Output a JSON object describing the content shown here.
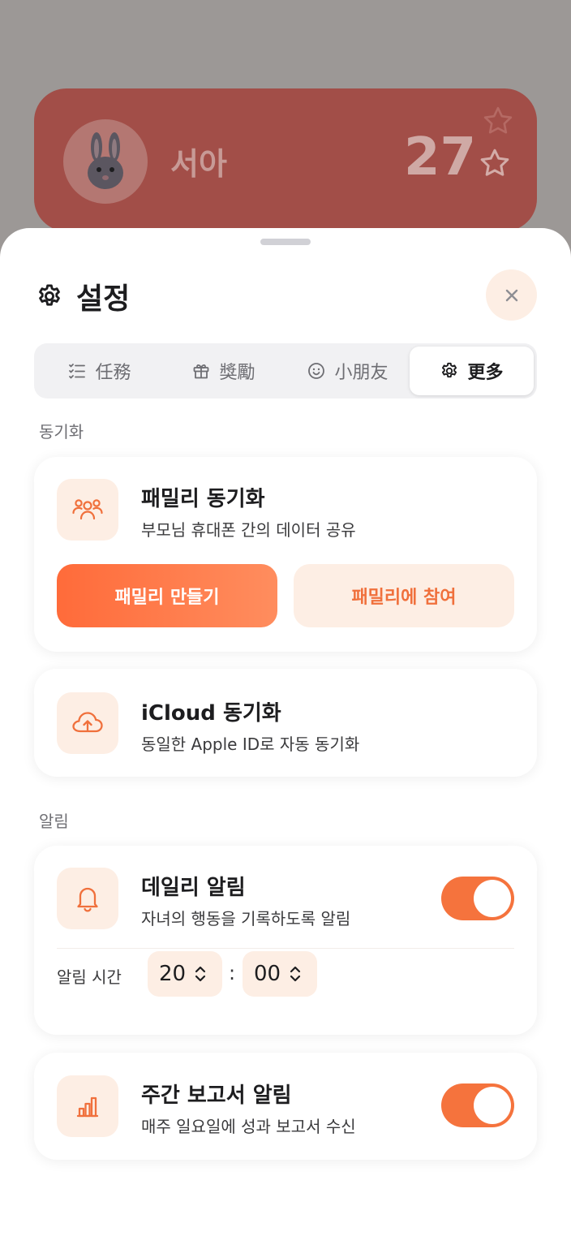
{
  "colors": {
    "accent": "#f5733d",
    "accent_light": "#fdeee4",
    "background_dim": "#9c9896",
    "profile_card": "#a24e48"
  },
  "profile": {
    "name": "서아",
    "score": "27",
    "avatar_icon": "rabbit-icon",
    "star_icon": "star-icon"
  },
  "sheet": {
    "title": "설정",
    "title_icon": "gear-icon",
    "close_icon": "close-icon"
  },
  "tabs": [
    {
      "label": "任務",
      "icon": "checklist-icon",
      "active": false
    },
    {
      "label": "獎勵",
      "icon": "gift-icon",
      "active": false
    },
    {
      "label": "小朋友",
      "icon": "smile-icon",
      "active": false
    },
    {
      "label": "更多",
      "icon": "gear-icon",
      "active": true
    }
  ],
  "sync": {
    "section_label": "동기화",
    "family": {
      "title": "패밀리 동기화",
      "subtitle": "부모님 휴대폰 간의 데이터 공유",
      "icon": "family-icon",
      "create_label": "패밀리 만들기",
      "join_label": "패밀리에 참여"
    },
    "icloud": {
      "title": "iCloud 동기화",
      "subtitle": "동일한 Apple ID로 자동 동기화",
      "icon": "cloud-upload-icon"
    }
  },
  "notifications": {
    "section_label": "알림",
    "daily": {
      "title": "데일리 알림",
      "subtitle": "자녀의 행동을 기록하도록 알림",
      "icon": "bell-icon",
      "enabled": true,
      "time_label": "알림 시간",
      "hour": "20",
      "colon": ":",
      "minute": "00"
    },
    "weekly": {
      "title": "주간 보고서 알림",
      "subtitle": "매주 일요일에 성과 보고서 수신",
      "icon": "bar-chart-icon",
      "enabled": true
    }
  }
}
